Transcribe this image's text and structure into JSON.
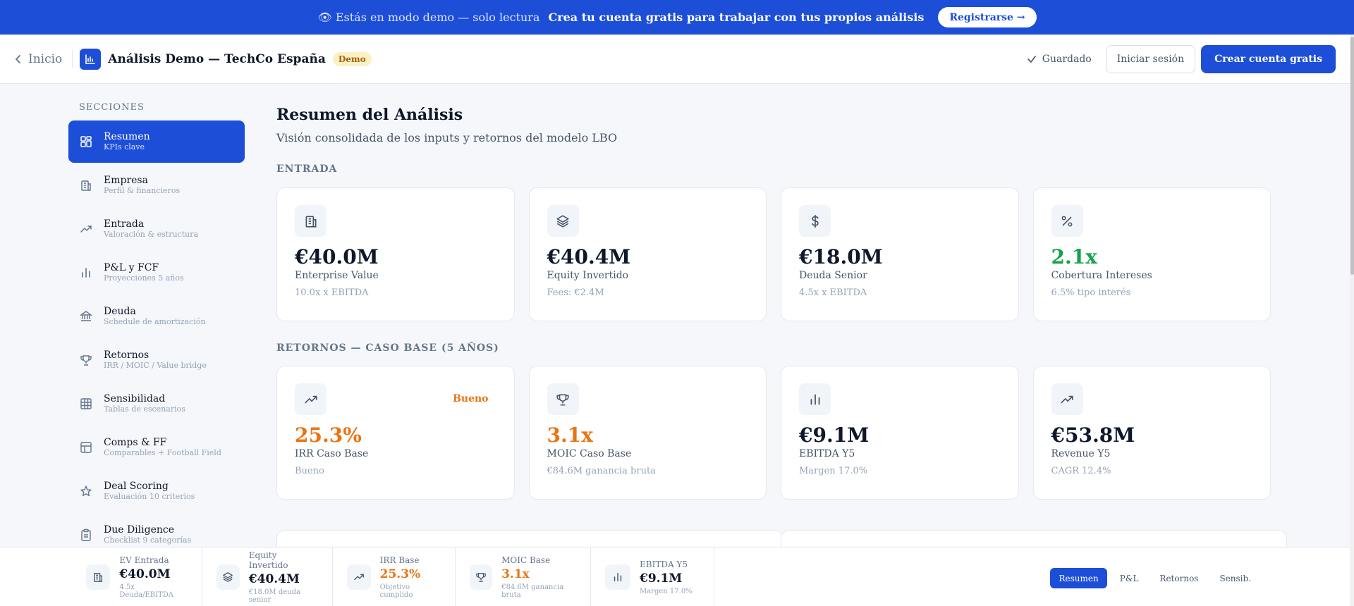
{
  "banner": {
    "text": "👁 Estás en modo demo — solo lectura",
    "cta": "Crea tu cuenta gratis para trabajar con tus propios análisis",
    "button": "Registrarse →"
  },
  "header": {
    "back_label": "Inicio",
    "title": "Análisis Demo — TechCo España",
    "badge": "Demo",
    "saved": "Guardado",
    "login": "Iniciar sesión",
    "signup": "Crear cuenta gratis"
  },
  "sidebar": {
    "heading": "SECCIONES",
    "items": [
      {
        "label": "Resumen",
        "sub": "KPIs clave",
        "icon": "dashboard-icon"
      },
      {
        "label": "Empresa",
        "sub": "Perfil & financieros",
        "icon": "building-icon"
      },
      {
        "label": "Entrada",
        "sub": "Valoración & estructura",
        "icon": "trending-up-icon"
      },
      {
        "label": "P&L y FCF",
        "sub": "Proyecciones 5 años",
        "icon": "bar-chart-icon"
      },
      {
        "label": "Deuda",
        "sub": "Schedule de amortización",
        "icon": "bank-icon"
      },
      {
        "label": "Retornos",
        "sub": "IRR / MOIC / Value bridge",
        "icon": "trophy-icon"
      },
      {
        "label": "Sensibilidad",
        "sub": "Tablas de escenarios",
        "icon": "grid-icon"
      },
      {
        "label": "Comps & FF",
        "sub": "Comparables + Football Field",
        "icon": "layout-icon"
      },
      {
        "label": "Deal Scoring",
        "sub": "Evaluación 10 criterios",
        "icon": "star-icon"
      },
      {
        "label": "Due Diligence",
        "sub": "Checklist 9 categorías",
        "icon": "clipboard-icon"
      }
    ]
  },
  "main": {
    "title": "Resumen del Análisis",
    "subtitle": "Visión consolidada de los inputs y retornos del modelo LBO",
    "entry_section": "ENTRADA",
    "entry_cards": [
      {
        "value": "€40.0M",
        "label": "Enterprise Value",
        "note": "10.0x x EBITDA",
        "icon": "building-icon"
      },
      {
        "value": "€40.4M",
        "label": "Equity Invertido",
        "note": "Fees: €2.4M",
        "icon": "layers-icon"
      },
      {
        "value": "€18.0M",
        "label": "Deuda Senior",
        "note": "4.5x x EBITDA",
        "icon": "dollar-icon"
      },
      {
        "value": "2.1x",
        "label": "Cobertura Intereses",
        "note": "6.5% tipo interés",
        "icon": "percent-icon"
      }
    ],
    "returns_section": "RETORNOS — CASO BASE (5 AÑOS)",
    "return_cards": [
      {
        "value": "25.3%",
        "label": "IRR Caso Base",
        "note": "Bueno",
        "tag": "Bueno",
        "icon": "trending-up-icon"
      },
      {
        "value": "3.1x",
        "label": "MOIC Caso Base",
        "note": "€84.6M ganancia bruta",
        "icon": "trophy-icon"
      },
      {
        "value": "€9.1M",
        "label": "EBITDA Y5",
        "note": "Margen 17.0%",
        "icon": "bar-chart-icon"
      },
      {
        "value": "€53.8M",
        "label": "Revenue Y5",
        "note": "CAGR 12.4%",
        "icon": "trending-up-icon"
      }
    ]
  },
  "bottom": {
    "kpis": [
      {
        "label": "EV Entrada",
        "value": "€40.0M",
        "note": "4.5x Deuda/EBITDA",
        "icon": "building-icon"
      },
      {
        "label": "Equity Invertido",
        "value": "€40.4M",
        "note": "€18.0M deuda senior",
        "icon": "layers-icon"
      },
      {
        "label": "IRR Base",
        "value": "25.3%",
        "note": "Objetivo cumplido",
        "icon": "trending-up-icon"
      },
      {
        "label": "MOIC Base",
        "value": "3.1x",
        "note": "€84.6M ganancia bruta",
        "icon": "trophy-icon"
      },
      {
        "label": "EBITDA Y5",
        "value": "€9.1M",
        "note": "Margen 17.0%",
        "icon": "bar-chart-icon"
      }
    ],
    "tabs": [
      "Resumen",
      "P&L",
      "Retornos",
      "Sensib."
    ]
  },
  "colors": {
    "accent": "#1d4ed8",
    "warning": "#ea7412",
    "success": "#16a34a"
  }
}
